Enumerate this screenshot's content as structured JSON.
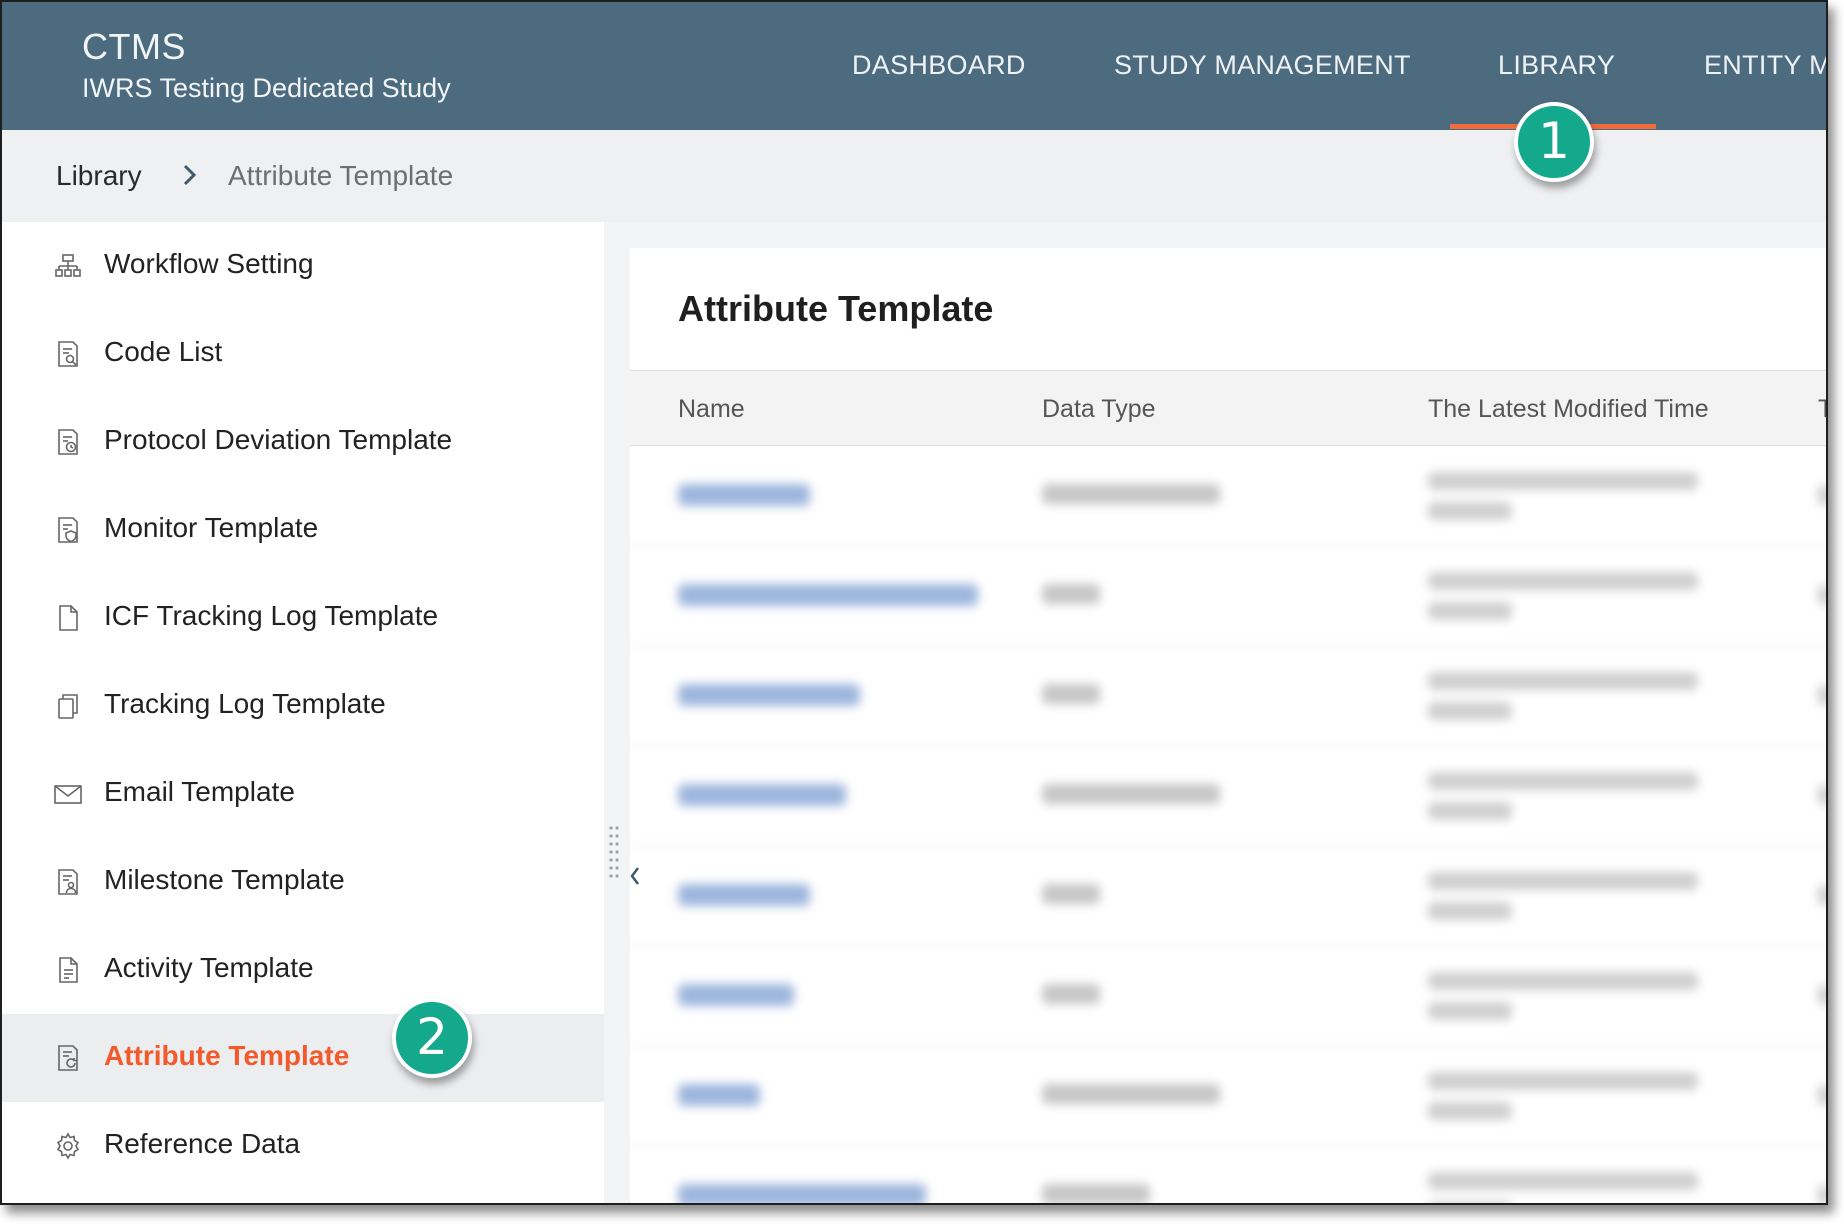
{
  "header": {
    "app_name": "CTMS",
    "study_name": "IWRS Testing Dedicated Study",
    "nav": [
      {
        "label": "DASHBOARD"
      },
      {
        "label": "STUDY MANAGEMENT"
      },
      {
        "label": "LIBRARY",
        "active": true
      },
      {
        "label": "ENTITY M"
      }
    ],
    "accent_color": "#f26b3a",
    "background_color": "#4d6b7e"
  },
  "breadcrumb": {
    "root": "Library",
    "separator_icon": "chevron-right-icon",
    "current": "Attribute Template"
  },
  "sidebar": {
    "items": [
      {
        "label": "Workflow Setting",
        "icon": "workflow-icon"
      },
      {
        "label": "Code List",
        "icon": "document-search-icon"
      },
      {
        "label": "Protocol Deviation Template",
        "icon": "document-clock-icon"
      },
      {
        "label": "Monitor Template",
        "icon": "document-shield-icon"
      },
      {
        "label": "ICF Tracking Log Template",
        "icon": "file-icon"
      },
      {
        "label": "Tracking Log Template",
        "icon": "copy-icon"
      },
      {
        "label": "Email Template",
        "icon": "mail-icon"
      },
      {
        "label": "Milestone Template",
        "icon": "document-user-icon"
      },
      {
        "label": "Activity Template",
        "icon": "document-lines-icon"
      },
      {
        "label": "Attribute Template",
        "icon": "document-refresh-icon",
        "active": true
      },
      {
        "label": "Reference Data",
        "icon": "gear-icon"
      }
    ],
    "active_color": "#f2592b"
  },
  "main": {
    "title": "Attribute Template",
    "columns": [
      "Name",
      "Data Type",
      "The Latest Modified Time",
      "T"
    ]
  },
  "callouts": [
    "1",
    "2"
  ]
}
